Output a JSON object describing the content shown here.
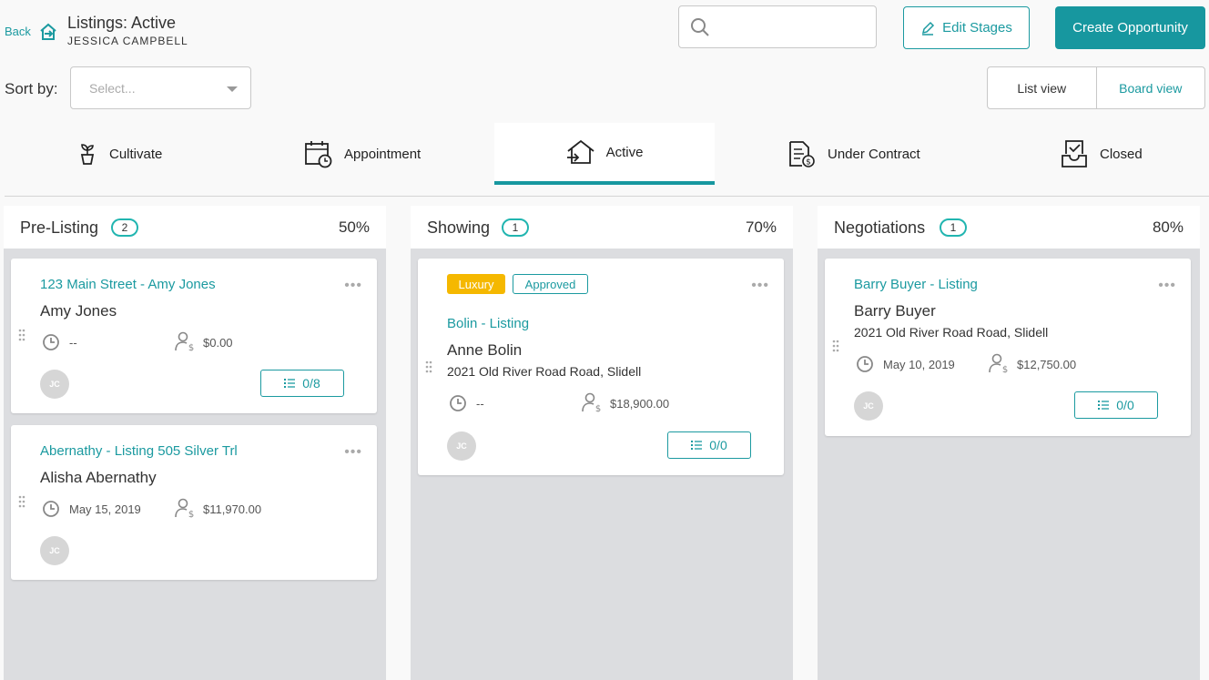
{
  "header": {
    "back_label": "Back",
    "title": "Listings: Active",
    "subtitle": "JESSICA CAMPBELL",
    "search_placeholder": "",
    "edit_stages_label": "Edit Stages",
    "create_label": "Create Opportunity"
  },
  "toolbar": {
    "sort_label": "Sort by:",
    "sort_placeholder": "Select...",
    "list_view_label": "List view",
    "board_view_label": "Board view"
  },
  "stages": [
    {
      "label": "Cultivate",
      "icon": "sprout-icon"
    },
    {
      "label": "Appointment",
      "icon": "calendar-clock-icon"
    },
    {
      "label": "Active",
      "icon": "house-arrow-icon",
      "active": true
    },
    {
      "label": "Under Contract",
      "icon": "document-dollar-icon"
    },
    {
      "label": "Closed",
      "icon": "inbox-check-icon"
    }
  ],
  "columns": [
    {
      "name": "Pre-Listing",
      "count": "2",
      "percent": "50%",
      "cards": [
        {
          "title": "123 Main Street - Amy Jones",
          "person": "Amy Jones",
          "date": "--",
          "amount": "$0.00",
          "avatar": "JC",
          "tasks": "0/8"
        },
        {
          "title": "Abernathy - Listing 505 Silver Trl",
          "person": "Alisha Abernathy",
          "date": "May 15, 2019",
          "amount": "$11,970.00",
          "avatar": "JC"
        }
      ]
    },
    {
      "name": "Showing",
      "count": "1",
      "percent": "70%",
      "cards": [
        {
          "tags": [
            "Luxury",
            "Approved"
          ],
          "title": "Bolin - Listing",
          "person": "Anne Bolin",
          "address": "2021 Old River Road Road, Slidell",
          "date": "--",
          "amount": "$18,900.00",
          "avatar": "JC",
          "tasks": "0/0"
        }
      ]
    },
    {
      "name": "Negotiations",
      "count": "1",
      "percent": "80%",
      "cards": [
        {
          "title": "Barry Buyer - Listing",
          "person": "Barry Buyer",
          "address": "2021 Old River Road Road, Slidell",
          "date": "May 10, 2019",
          "amount": "$12,750.00",
          "avatar": "JC",
          "tasks": "0/0"
        }
      ]
    }
  ],
  "colors": {
    "accent": "#17979f",
    "link": "#1b9aa0",
    "count_ring": "#21b5b0",
    "luxury": "#f5b800",
    "board_bg": "#dcdde0"
  }
}
